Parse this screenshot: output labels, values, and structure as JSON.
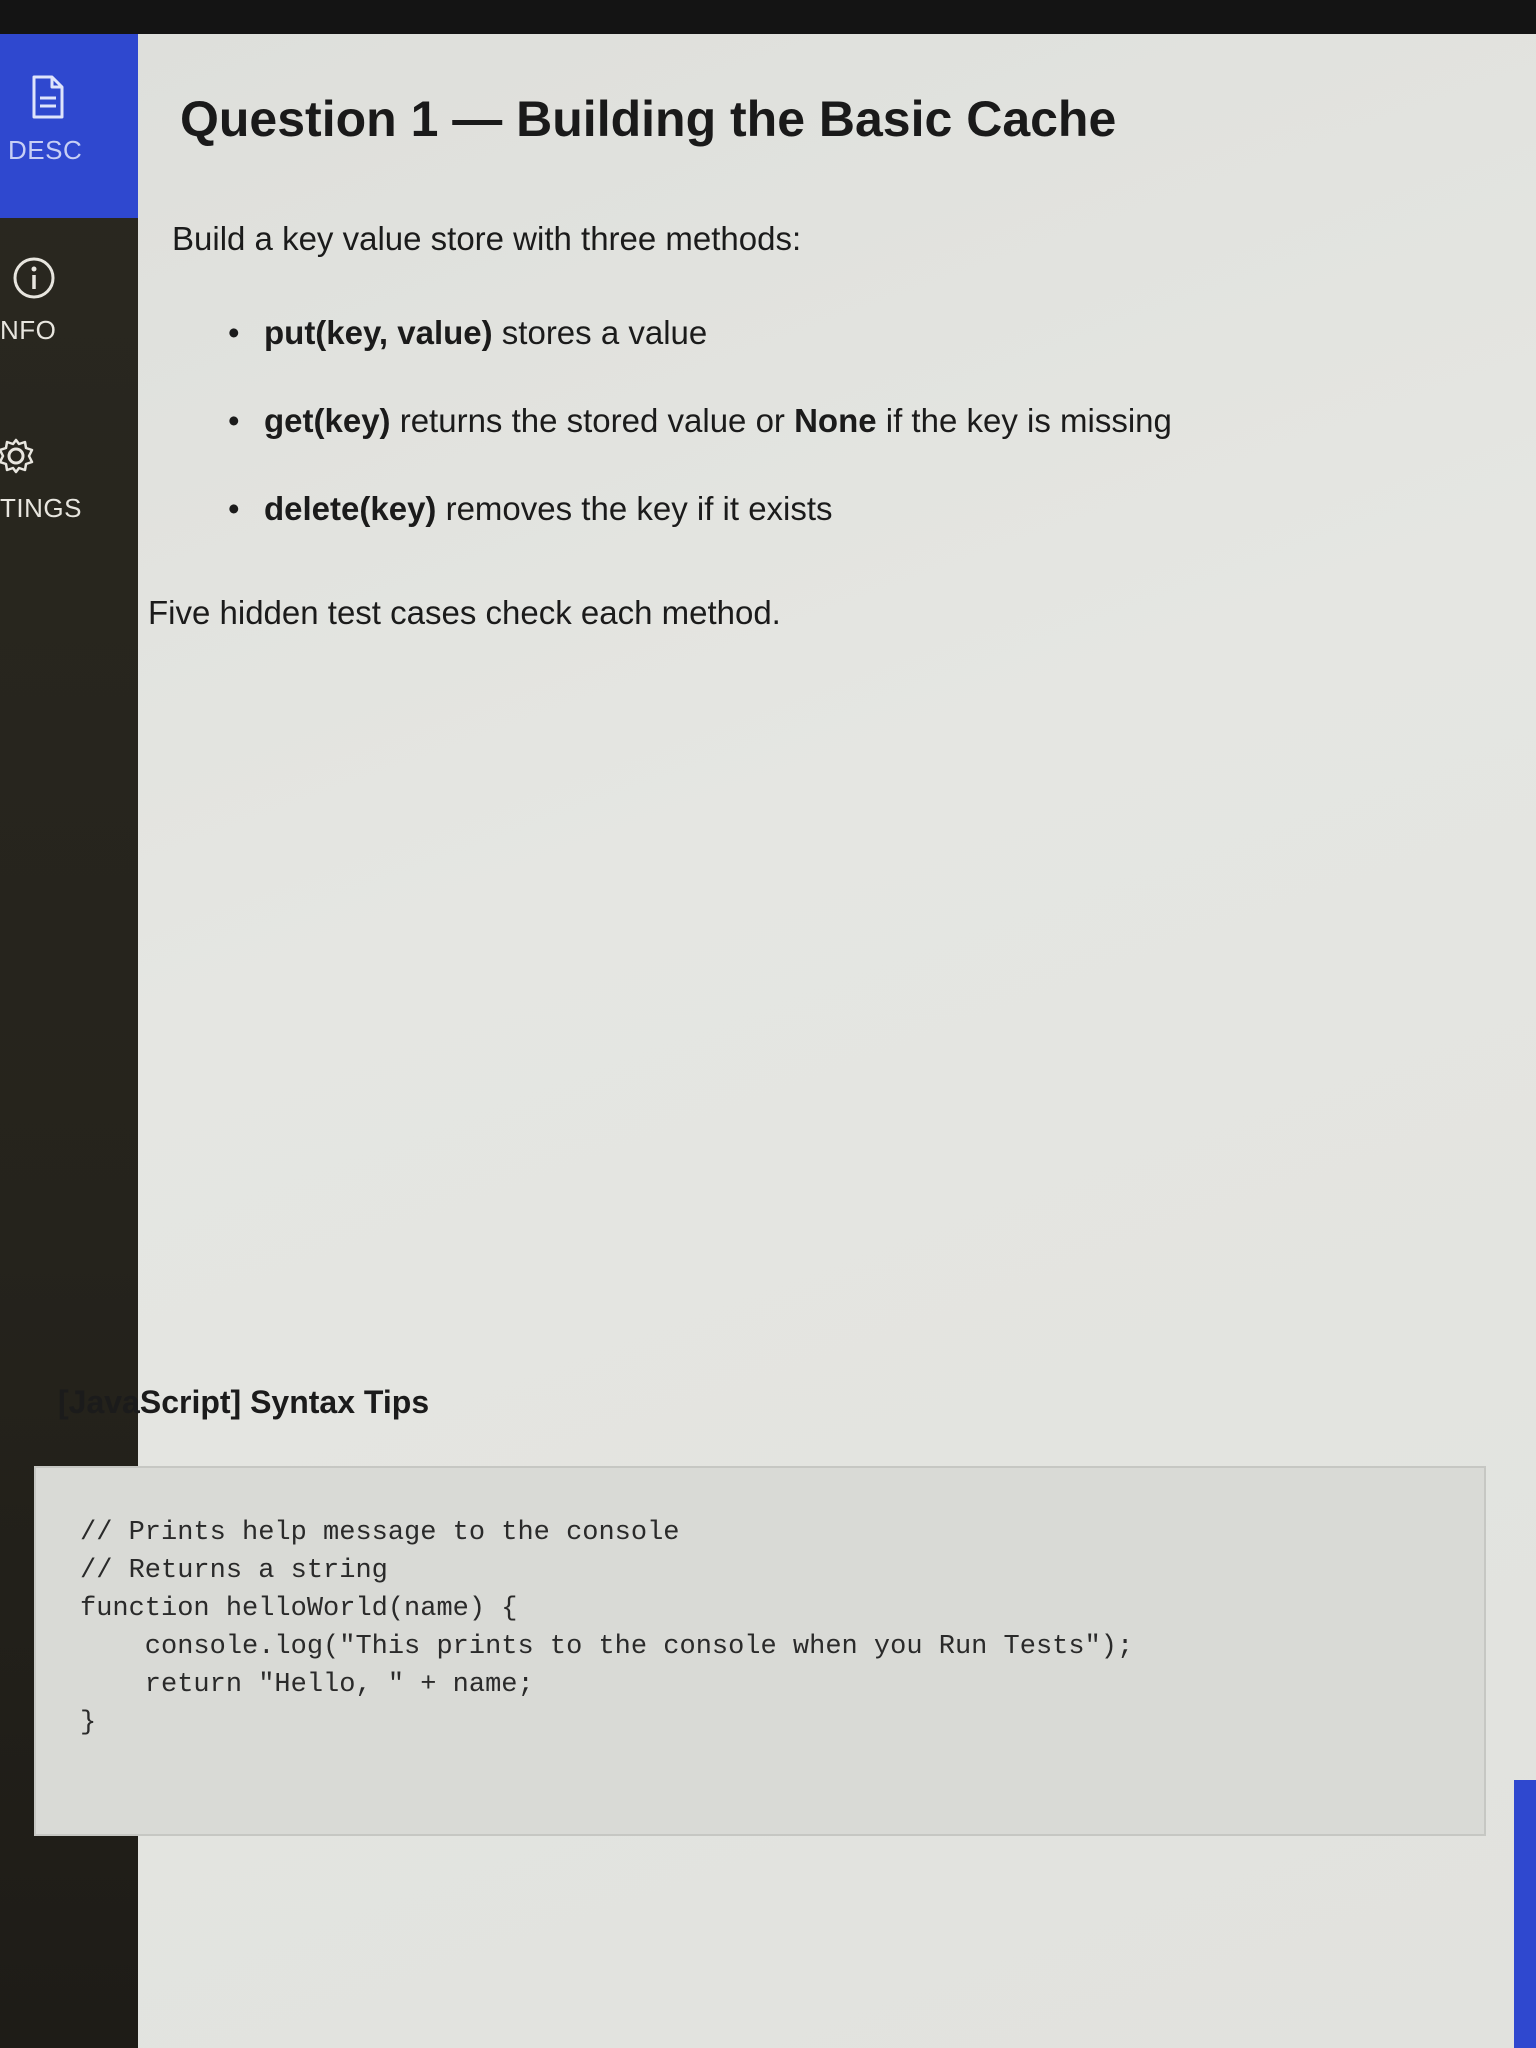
{
  "sidebar": {
    "items": [
      {
        "label": "DESC",
        "icon": "document-icon",
        "active": true
      },
      {
        "label": "NFO",
        "icon": "info-icon",
        "active": false
      },
      {
        "label": "TINGS",
        "icon": "gear-icon",
        "active": false
      }
    ]
  },
  "question": {
    "title": "Question 1 — Building the Basic Cache",
    "intro": "Build a key value store with three methods:",
    "methods": [
      {
        "code": "put(key, value)",
        "text": " stores a value"
      },
      {
        "code": "get(key)",
        "text": " returns the stored value or ",
        "strong": "None",
        "tail": " if the key is missing"
      },
      {
        "code": "delete(key)",
        "text": " removes the key if it exists"
      }
    ],
    "closing": "Five hidden test cases check each method."
  },
  "tips": {
    "title": "[JavaScript] Syntax Tips",
    "code": "// Prints help message to the console\n// Returns a string\nfunction helloWorld(name) {\n    console.log(\"This prints to the console when you Run Tests\");\n    return \"Hello, \" + name;\n}"
  },
  "colors": {
    "accent": "#2f48cf",
    "sidebar_bg": "#2a2820",
    "content_bg": "#e2e3df"
  }
}
